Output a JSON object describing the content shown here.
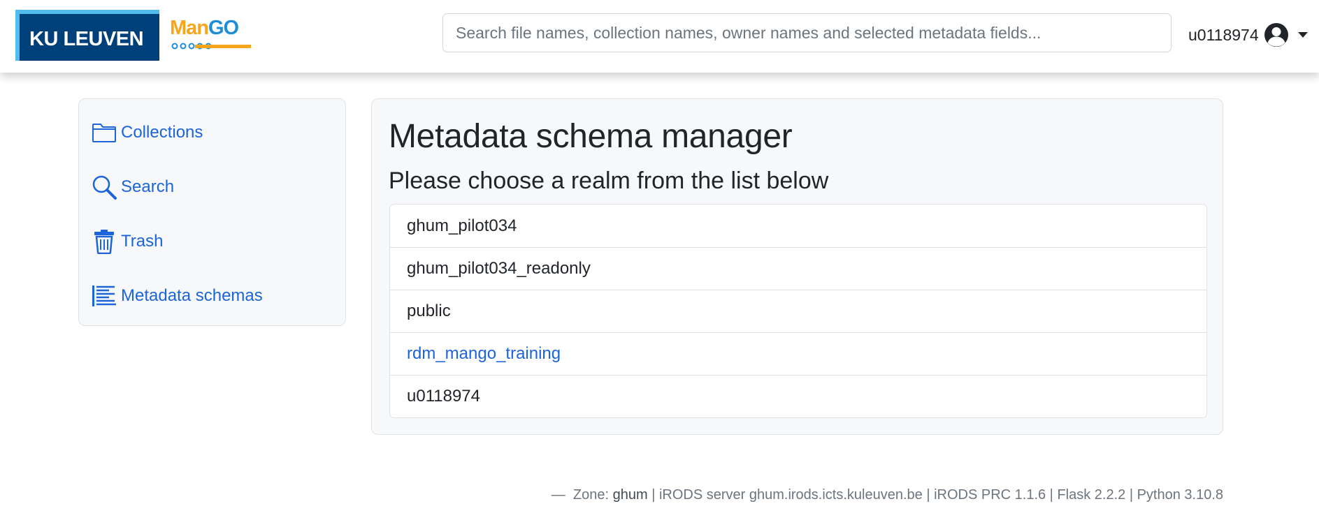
{
  "header": {
    "ku_logo_text": "KU LEUVEN",
    "mango_logo_part1": "Man",
    "mango_logo_part2": "GO",
    "search_placeholder": "Search file names, collection names, owner names and selected metadata fields...",
    "user_name": "u0118974"
  },
  "sidebar": {
    "items": [
      {
        "label": "Collections",
        "icon": "folder-icon"
      },
      {
        "label": "Search",
        "icon": "search-icon"
      },
      {
        "label": "Trash",
        "icon": "trash-icon"
      },
      {
        "label": "Metadata schemas",
        "icon": "list-icon"
      }
    ]
  },
  "main": {
    "title": "Metadata schema manager",
    "subtitle": "Please choose a realm from the list below",
    "realms": [
      "ghum_pilot034",
      "ghum_pilot034_readonly",
      "public",
      "rdm_mango_training",
      "u0118974"
    ]
  },
  "footer": {
    "dash": "—",
    "zone_label": "Zone:",
    "zone_value": "ghum",
    "rest": "| iRODS server ghum.irods.icts.kuleuven.be | iRODS PRC 1.1.6 | Flask 2.2.2 | Python 3.10.8"
  },
  "colors": {
    "ku_blue": "#00407a",
    "ku_light_blue": "#52bdec",
    "mango_orange": "#f6a51c",
    "mango_blue": "#1d8dd8",
    "link_blue": "#1b64d9"
  }
}
